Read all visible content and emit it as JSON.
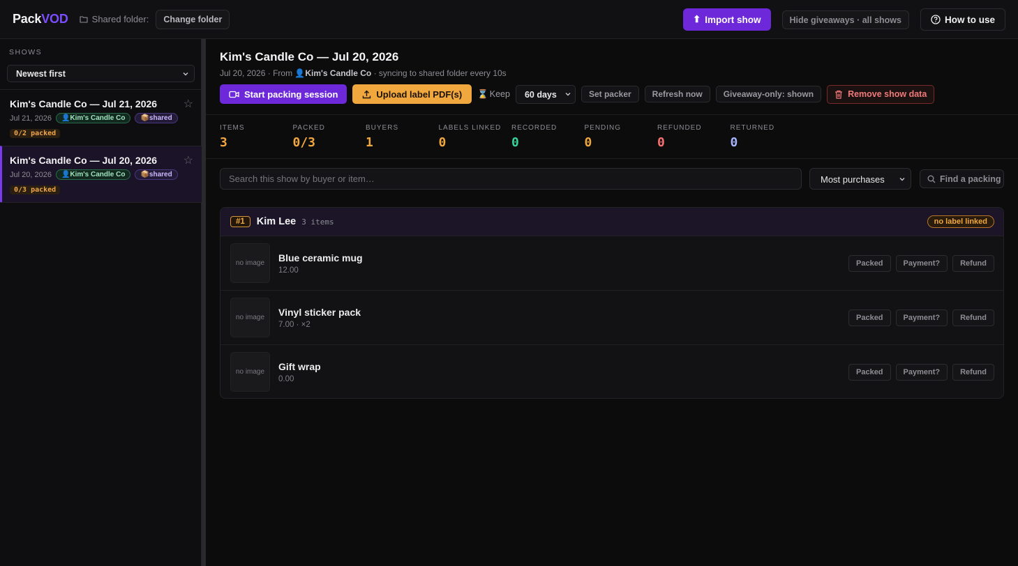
{
  "app": {
    "logo_main": "Pack",
    "logo_accent": "VOD",
    "folder_label": "Shared folder:",
    "change_folder": "Change folder"
  },
  "top": {
    "import": "Import show",
    "hide_giveaways": "Hide giveaways · all shows",
    "how_to_use": "How to use"
  },
  "sidebar": {
    "label": "SHOWS",
    "sort": "Newest first",
    "items": [
      {
        "title": "Kim's Candle Co — Jul 21, 2026",
        "date": "Jul 21, 2026",
        "user": "Kim's Candle Co",
        "shared": "shared",
        "packed": "0/2 packed"
      },
      {
        "title": "Kim's Candle Co — Jul 20, 2026",
        "date": "Jul 20, 2026",
        "user": "Kim's Candle Co",
        "shared": "shared",
        "packed": "0/3 packed"
      }
    ]
  },
  "show": {
    "title": "Kim's Candle Co — Jul 20, 2026",
    "date": "Jul 20, 2026",
    "from_prefix": "· From",
    "from": "Kim's Candle Co",
    "sync": "· syncing to shared folder every 10s",
    "start_session": "Start packing session",
    "upload_labels": "Upload label PDF(s)",
    "keep_label": "Keep",
    "keep_value": "60 days",
    "set_packer": "Set packer",
    "refresh": "Refresh now",
    "giveaway_only": "Giveaway-only: shown",
    "remove": "Remove show data"
  },
  "stats": [
    {
      "label": "ITEMS",
      "value": "3",
      "color": "#f0a73e"
    },
    {
      "label": "PACKED",
      "value": "0/3",
      "color": "#f0a73e"
    },
    {
      "label": "BUYERS",
      "value": "1",
      "color": "#f0a73e"
    },
    {
      "label": "LABELS LINKED",
      "value": "0",
      "color": "#f0a73e"
    },
    {
      "label": "RECORDED",
      "value": "0",
      "color": "#34d399"
    },
    {
      "label": "PENDING",
      "value": "0",
      "color": "#f0a73e"
    },
    {
      "label": "REFUNDED",
      "value": "0",
      "color": "#f87171"
    },
    {
      "label": "RETURNED",
      "value": "0",
      "color": "#a5b4fc"
    }
  ],
  "search": {
    "placeholder": "Search this show by buyer or item…",
    "sort": "Most purchases",
    "find": "Find a packing"
  },
  "buyer": {
    "rank": "#1",
    "name": "Kim Lee",
    "count": "3 items",
    "badge": "no label linked",
    "items": [
      {
        "thumb": "no image",
        "name": "Blue ceramic mug",
        "price": "12.00"
      },
      {
        "thumb": "no image",
        "name": "Vinyl sticker pack",
        "price": "7.00 · ×2"
      },
      {
        "thumb": "no image",
        "name": "Gift wrap",
        "price": "0.00"
      }
    ],
    "btn_packed": "Packed",
    "btn_payment": "Payment?",
    "btn_refund": "Refund"
  }
}
